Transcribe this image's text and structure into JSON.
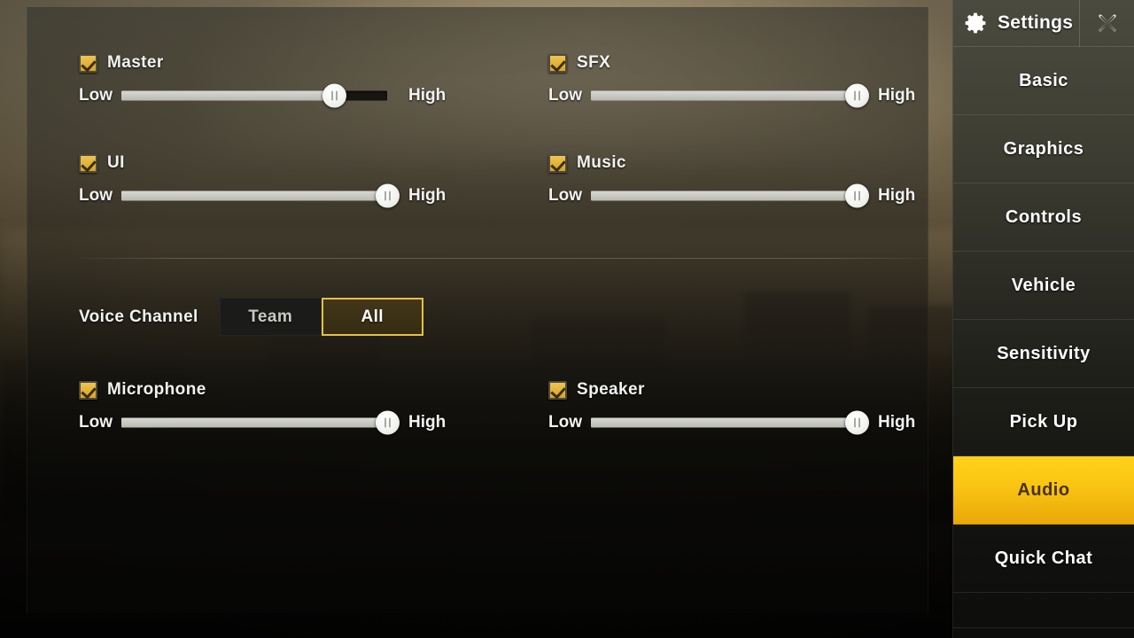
{
  "app": {
    "title": "Settings"
  },
  "colors": {
    "accent": "#ffd21a",
    "checkbox": "#e3b83c",
    "selected_border": "#e3c23f",
    "text": "#ffffff"
  },
  "sidebar": {
    "header": {
      "title": "Settings",
      "gear_icon": "gear-icon",
      "close_icon": "close-x-icon"
    },
    "items": [
      {
        "label": "Basic",
        "active": false
      },
      {
        "label": "Graphics",
        "active": false
      },
      {
        "label": "Controls",
        "active": false
      },
      {
        "label": "Vehicle",
        "active": false
      },
      {
        "label": "Sensitivity",
        "active": false
      },
      {
        "label": "Pick Up",
        "active": false
      },
      {
        "label": "Audio",
        "active": true
      },
      {
        "label": "Quick Chat",
        "active": false
      }
    ]
  },
  "main": {
    "volume_sliders": [
      {
        "name": "Master",
        "checked": true,
        "low_label": "Low",
        "high_label": "High",
        "value": 80,
        "column": "left",
        "row": 1
      },
      {
        "name": "SFX",
        "checked": true,
        "low_label": "Low",
        "high_label": "High",
        "value": 100,
        "column": "right",
        "row": 1
      },
      {
        "name": "UI",
        "checked": true,
        "low_label": "Low",
        "high_label": "High",
        "value": 100,
        "column": "left",
        "row": 2
      },
      {
        "name": "Music",
        "checked": true,
        "low_label": "Low",
        "high_label": "High",
        "value": 100,
        "column": "right",
        "row": 2
      },
      {
        "name": "Microphone",
        "checked": true,
        "low_label": "Low",
        "high_label": "High",
        "value": 100,
        "column": "left",
        "row": 3
      },
      {
        "name": "Speaker",
        "checked": true,
        "low_label": "Low",
        "high_label": "High",
        "value": 100,
        "column": "right",
        "row": 3
      }
    ],
    "voice_channel": {
      "label": "Voice Channel",
      "options": [
        {
          "label": "Team",
          "selected": false
        },
        {
          "label": "All",
          "selected": true
        }
      ]
    }
  }
}
